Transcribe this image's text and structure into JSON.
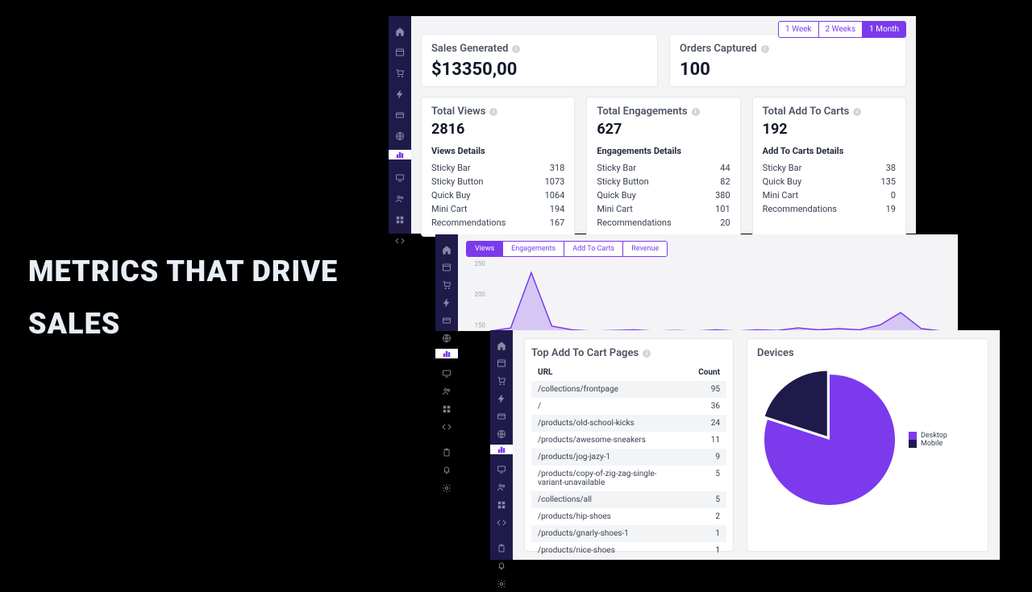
{
  "headline_l1": "METRICS THAT DRIVE",
  "headline_l2": "SALES",
  "timeranges": [
    "1 Week",
    "2 Weeks",
    "1 Month"
  ],
  "timerange_selected": 2,
  "summary": {
    "sales": {
      "label": "Sales Generated",
      "value": "$13350,00"
    },
    "orders": {
      "label": "Orders Captured",
      "value": "100"
    }
  },
  "stats": [
    {
      "label": "Total Views",
      "value": "2816",
      "details_title": "Views Details",
      "rows": [
        {
          "k": "Sticky Bar",
          "v": "318"
        },
        {
          "k": "Sticky Button",
          "v": "1073"
        },
        {
          "k": "Quick Buy",
          "v": "1064"
        },
        {
          "k": "Mini Cart",
          "v": "194"
        },
        {
          "k": "Recommendations",
          "v": "167"
        }
      ]
    },
    {
      "label": "Total Engagements",
      "value": "627",
      "details_title": "Engagements Details",
      "rows": [
        {
          "k": "Sticky Bar",
          "v": "44"
        },
        {
          "k": "Sticky Button",
          "v": "82"
        },
        {
          "k": "Quick Buy",
          "v": "380"
        },
        {
          "k": "Mini Cart",
          "v": "101"
        },
        {
          "k": "Recommendations",
          "v": "20"
        }
      ]
    },
    {
      "label": "Total Add To Carts",
      "value": "192",
      "details_title": "Add To Carts Details",
      "rows": [
        {
          "k": "Sticky Bar",
          "v": "38"
        },
        {
          "k": "Quick Buy",
          "v": "135"
        },
        {
          "k": "Mini Cart",
          "v": "0"
        },
        {
          "k": "Recommendations",
          "v": "19"
        }
      ]
    }
  ],
  "chart_tabs": [
    "Views",
    "Engagements",
    "Add To Carts",
    "Revenue"
  ],
  "chart_tab_selected": 0,
  "chart_data": {
    "type": "line",
    "ylabel": "",
    "xlabel": "",
    "ylim": [
      0,
      250
    ],
    "y_ticks": [
      150,
      200,
      250
    ],
    "series": [
      {
        "name": "Views",
        "values": [
          140,
          145,
          235,
          148,
          142,
          140,
          141,
          142,
          140,
          141,
          140,
          142,
          140,
          142,
          141,
          145,
          142,
          144,
          142,
          150,
          170,
          144,
          140
        ]
      }
    ],
    "color": "#7c3aed"
  },
  "top_pages": {
    "title": "Top Add To Cart Pages",
    "headers": [
      "URL",
      "Count"
    ],
    "rows": [
      {
        "url": "/collections/frontpage",
        "count": "95"
      },
      {
        "url": "/",
        "count": "36"
      },
      {
        "url": "/products/old-school-kicks",
        "count": "24"
      },
      {
        "url": "/products/awesome-sneakers",
        "count": "11"
      },
      {
        "url": "/products/jog-jazy-1",
        "count": "9"
      },
      {
        "url": "/products/copy-of-zig-zag-single-variant-unavailable",
        "count": "5"
      },
      {
        "url": "/collections/all",
        "count": "5"
      },
      {
        "url": "/products/hip-shoes",
        "count": "2"
      },
      {
        "url": "/products/gnarly-shoes-1",
        "count": "1"
      },
      {
        "url": "/products/nice-shoes",
        "count": "1"
      }
    ]
  },
  "devices": {
    "title": "Devices",
    "chart_data": {
      "type": "pie",
      "series": [
        {
          "name": "Desktop",
          "value": 80,
          "color": "#7c3aed"
        },
        {
          "name": "Mobile",
          "value": 20,
          "color": "#1e1b4b"
        }
      ]
    }
  },
  "sidebar_icons": [
    "home",
    "window",
    "cart",
    "bolt",
    "card",
    "globe",
    "chart",
    "monitor",
    "users",
    "grid",
    "code"
  ],
  "sidebar_icons3": [
    "home",
    "window",
    "cart",
    "bolt",
    "card",
    "globe",
    "chart",
    "monitor",
    "users",
    "grid",
    "code",
    "",
    "clipboard",
    "bell",
    "gear"
  ]
}
